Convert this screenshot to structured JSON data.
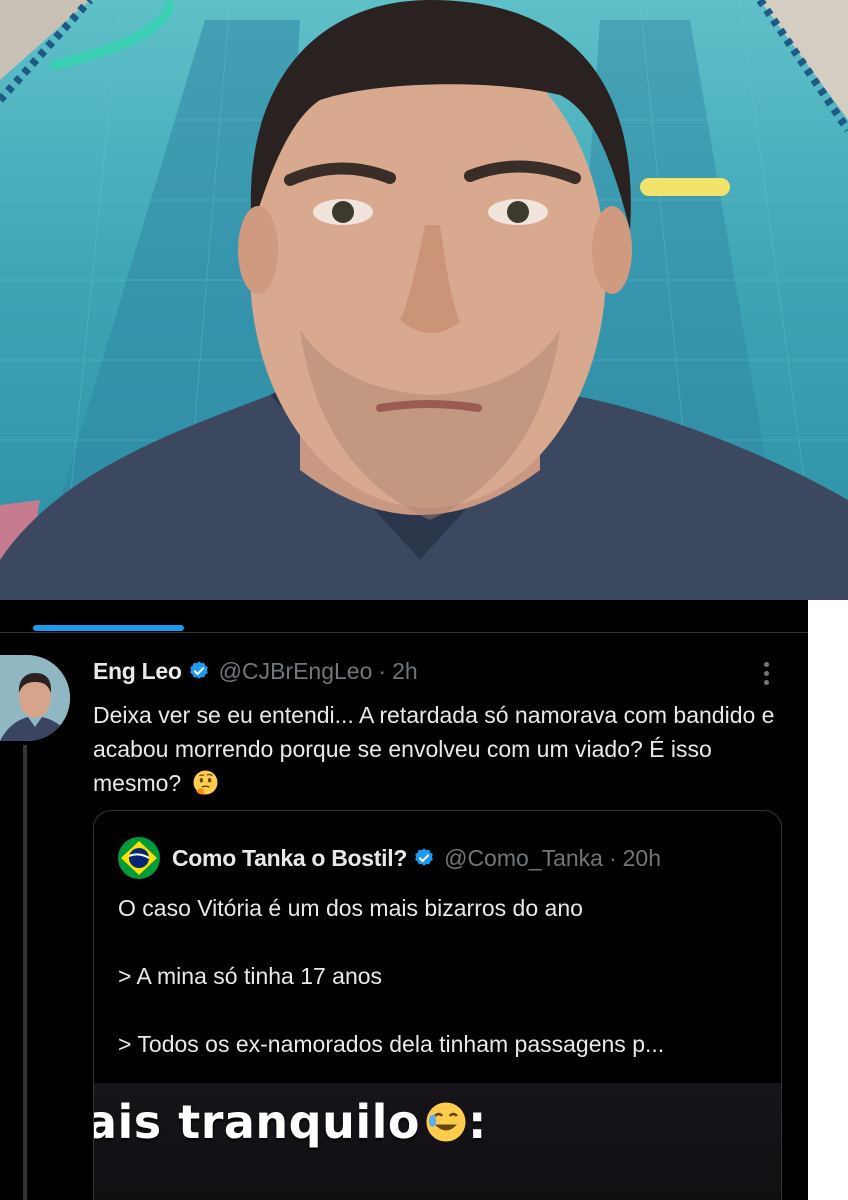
{
  "photo": {
    "icon": "selfie-photo"
  },
  "tweet": {
    "author_name": "Eng Leo",
    "author_handle": "@CJBrEngLeo",
    "separator": "·",
    "time": "2h",
    "text": "Deixa ver se eu entendi... A retardada só namorava com bandido e acabou morrendo porque se envolveu com um viado? É isso mesmo?",
    "emoji": "thinking-face"
  },
  "quoted_tweet": {
    "author_name": "Como Tanka o Bostil?",
    "author_handle": "@Como_Tanka",
    "separator": "·",
    "time": "20h",
    "lines": [
      "O caso Vitória é um dos mais bizarros do ano",
      "> A mina só tinha 17 anos",
      "> Todos os ex-namorados dela tinham passagens p..."
    ],
    "media_caption": "ais tranquilo",
    "media_caption_suffix": ":"
  },
  "colors": {
    "accent": "#1d9bf0",
    "text_primary": "#e7e9ea",
    "text_secondary": "#71767b",
    "background": "#000000",
    "border": "#2f3336"
  }
}
